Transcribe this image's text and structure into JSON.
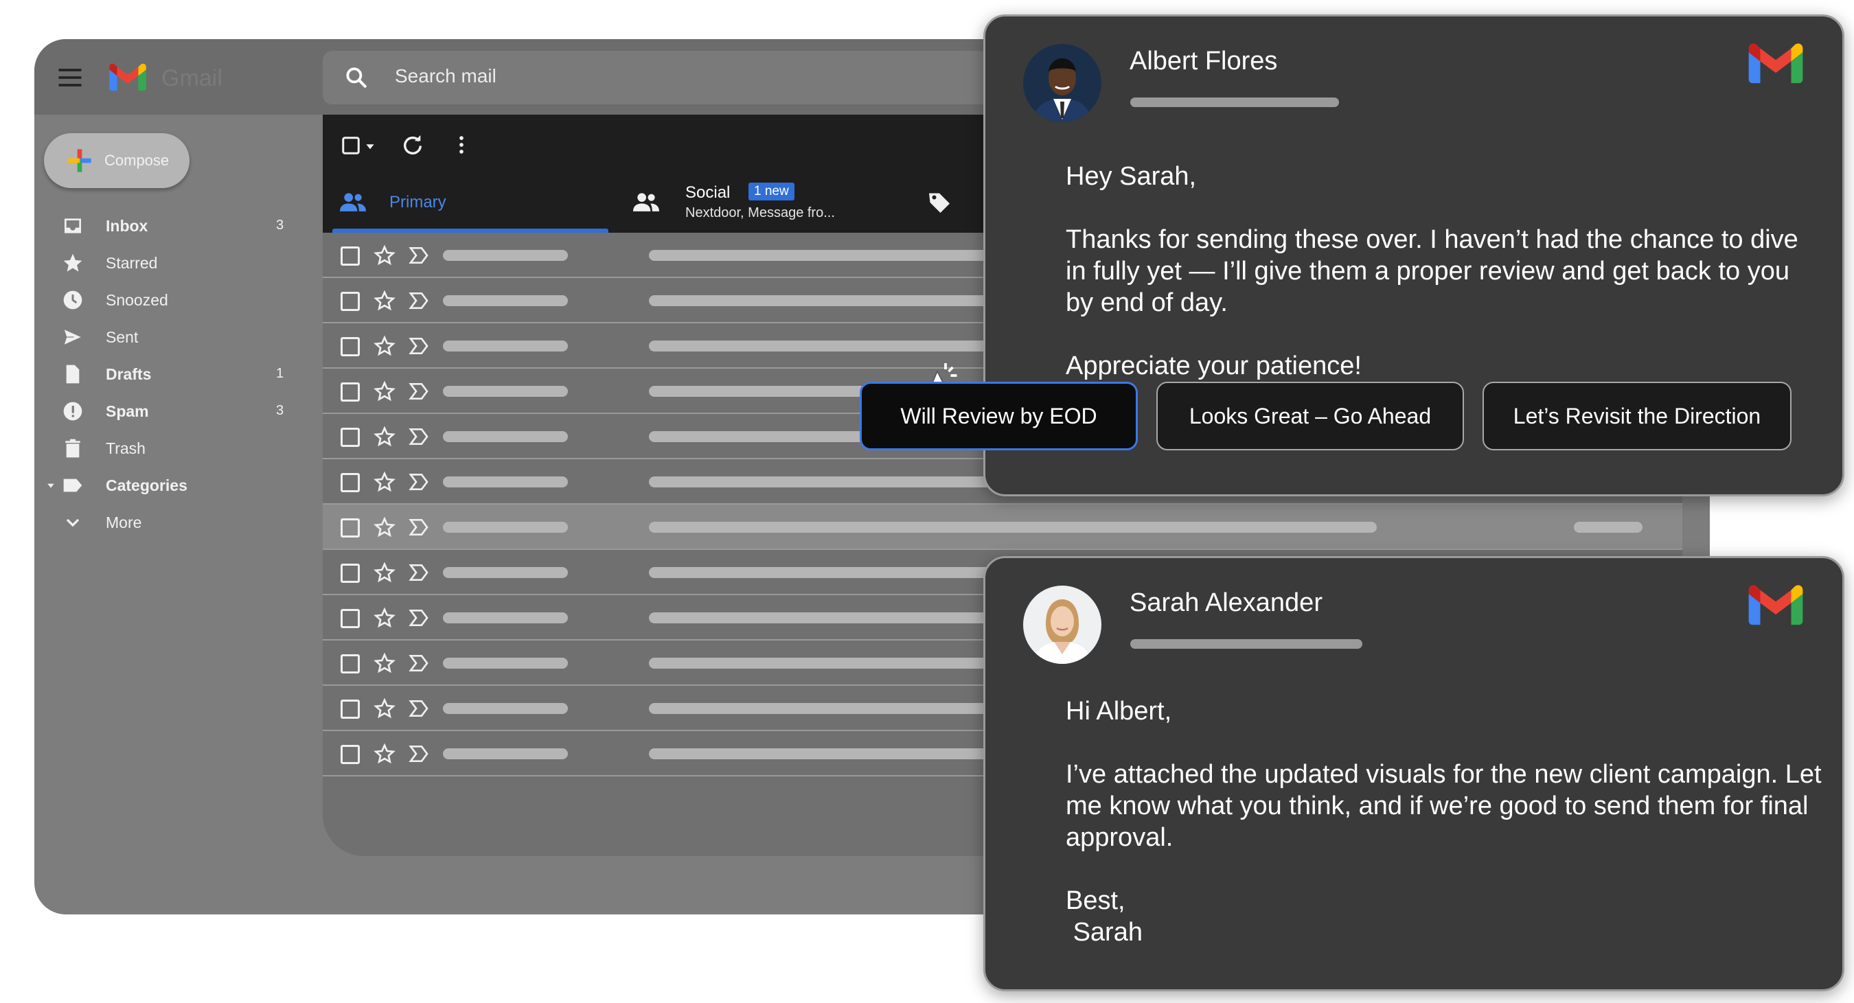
{
  "app": {
    "name": "Gmail"
  },
  "search": {
    "placeholder": "Search mail"
  },
  "compose": {
    "label": "Compose"
  },
  "sidebar": {
    "items": [
      {
        "label": "Inbox",
        "count": "3",
        "icon": "inbox-icon",
        "bold": true
      },
      {
        "label": "Starred",
        "count": "",
        "icon": "star-icon",
        "bold": false
      },
      {
        "label": "Snoozed",
        "count": "",
        "icon": "clock-icon",
        "bold": false
      },
      {
        "label": "Sent",
        "count": "",
        "icon": "send-icon",
        "bold": false
      },
      {
        "label": "Drafts",
        "count": "1",
        "icon": "draft-icon",
        "bold": true
      },
      {
        "label": "Spam",
        "count": "3",
        "icon": "spam-icon",
        "bold": true
      },
      {
        "label": "Trash",
        "count": "",
        "icon": "trash-icon",
        "bold": false
      },
      {
        "label": "Categories",
        "count": "",
        "icon": "label-icon",
        "bold": true
      },
      {
        "label": "More",
        "count": "",
        "icon": "chevron-down-icon",
        "bold": false
      }
    ]
  },
  "tabs": {
    "primary": {
      "label": "Primary"
    },
    "social": {
      "label": "Social",
      "badge": "1 new",
      "preview": "Nextdoor, Message fro..."
    }
  },
  "inbox": {
    "row_count": 12,
    "highlighted_row": 7
  },
  "messages": [
    {
      "sender": "Albert Flores",
      "body": "Hey Sarah,\n\nThanks for sending these over. I haven’t had the chance to dive in fully yet — I’ll give them a proper review and get back to you by end of day.\n\nAppreciate your patience!",
      "replies": [
        "Will Review by EOD",
        "Looks Great – Go Ahead",
        "Let’s Revisit the Direction"
      ],
      "selected_reply": "Will Review by EOD"
    },
    {
      "sender": "Sarah Alexander",
      "body": "Hi Albert,\n\nI’ve attached the updated visuals for the new client campaign. Let me know what you think, and if we’re good to send them for final approval.\n\nBest,\n Sarah"
    }
  ],
  "colors": {
    "accent_blue": "#2f6fd6",
    "card_bg": "#3a3a3a",
    "gmail_red": "#ea4335",
    "gmail_blue": "#4285f4",
    "gmail_green": "#34a853",
    "gmail_yellow": "#fbbc04"
  }
}
